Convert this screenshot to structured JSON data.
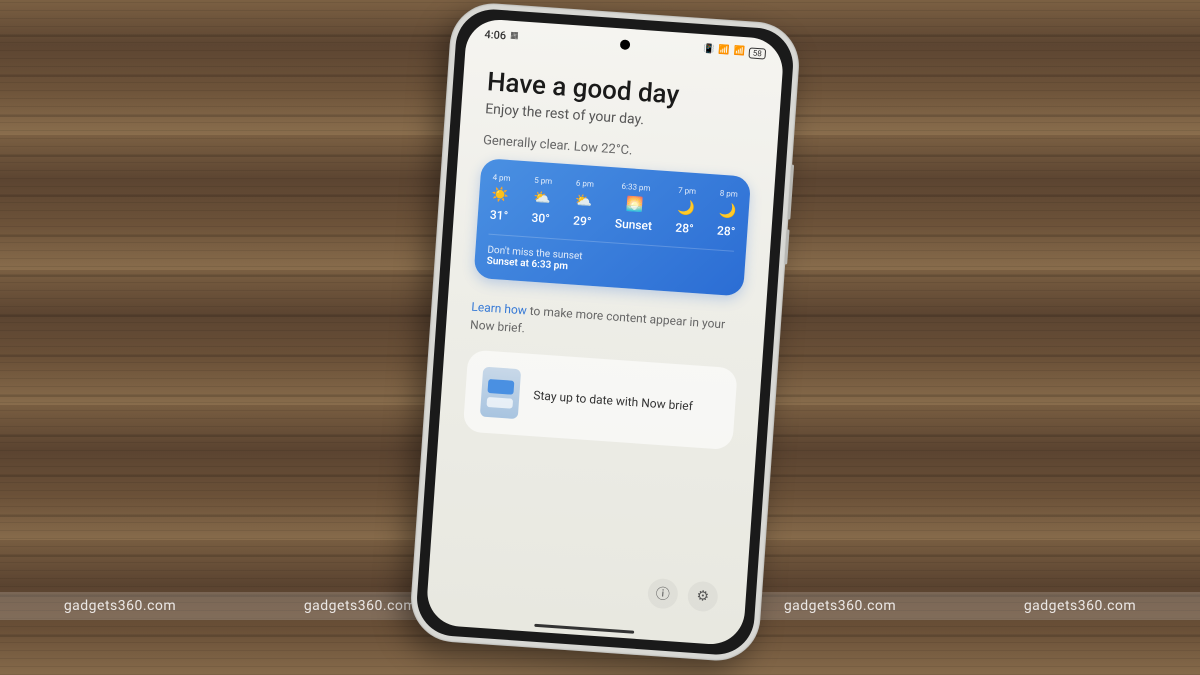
{
  "watermark": "gadgets360.com",
  "statusBar": {
    "time": "4:06",
    "dateIcon": "📅",
    "battery": "58"
  },
  "header": {
    "title": "Have a good day",
    "subtitle": "Enjoy the rest of your day."
  },
  "weather": {
    "summary": "Generally clear. Low 22°C.",
    "hourly": [
      {
        "time": "4 pm",
        "icon": "☀️",
        "temp": "31°"
      },
      {
        "time": "5 pm",
        "icon": "⛅",
        "temp": "30°"
      },
      {
        "time": "6 pm",
        "icon": "⛅",
        "temp": "29°"
      },
      {
        "time": "6:33 pm",
        "icon": "🌅",
        "temp": "Sunset"
      },
      {
        "time": "7 pm",
        "icon": "🌙",
        "temp": "28°"
      },
      {
        "time": "8 pm",
        "icon": "🌙",
        "temp": "28°"
      }
    ],
    "sunsetNote": {
      "label": "Don't miss the sunset",
      "time": "Sunset at 6:33 pm"
    }
  },
  "learn": {
    "link": "Learn how",
    "rest": " to make more content appear in your Now brief."
  },
  "infoCard": {
    "text": "Stay up to date with Now brief"
  },
  "icons": {
    "alert": "⊙",
    "settings": "⚙"
  }
}
